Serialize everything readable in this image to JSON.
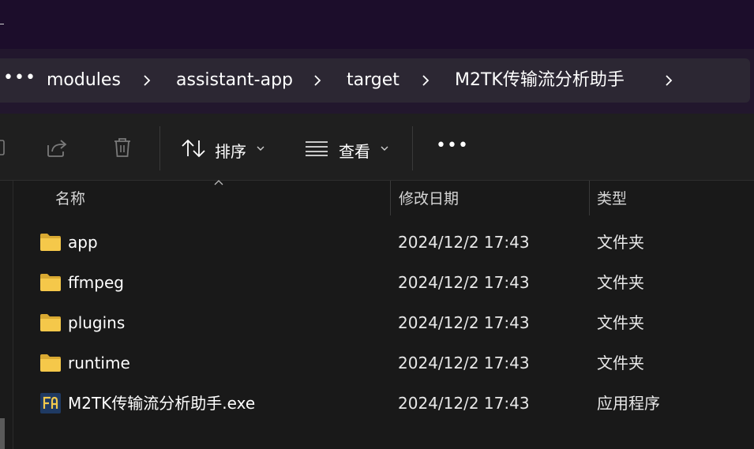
{
  "address": {
    "overflow": "•••",
    "crumbs": [
      "modules",
      "assistant-app",
      "target",
      "M2TK传输流分析助手"
    ]
  },
  "toolbar": {
    "sort_label": "排序",
    "view_label": "查看",
    "more_label": "•••"
  },
  "columns": {
    "name": "名称",
    "date": "修改日期",
    "type": "类型"
  },
  "files": [
    {
      "name": "app",
      "date": "2024/12/2 17:43",
      "type": "文件夹",
      "icon": "folder-icon"
    },
    {
      "name": "ffmpeg",
      "date": "2024/12/2 17:43",
      "type": "文件夹",
      "icon": "folder-icon"
    },
    {
      "name": "plugins",
      "date": "2024/12/2 17:43",
      "type": "文件夹",
      "icon": "folder-icon"
    },
    {
      "name": "runtime",
      "date": "2024/12/2 17:43",
      "type": "文件夹",
      "icon": "folder-icon"
    },
    {
      "name": "M2TK传输流分析助手.exe",
      "date": "2024/12/2 17:43",
      "type": "应用程序",
      "icon": "exe-app-icon"
    }
  ],
  "colors": {
    "titlebar": "#1c0d2b",
    "folder": "#f2c94c",
    "background": "#191919"
  }
}
